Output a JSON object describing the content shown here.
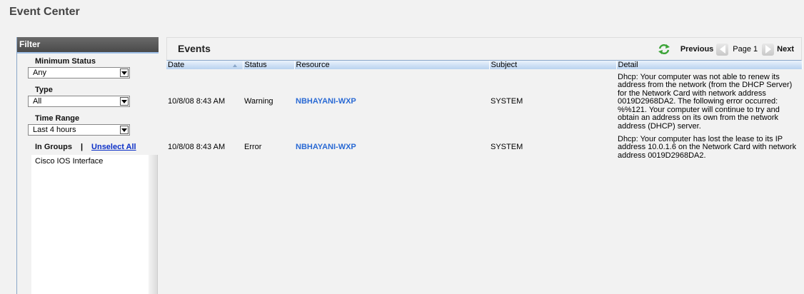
{
  "page": {
    "title": "Event Center"
  },
  "filter": {
    "header": "Filter",
    "minimum_status": {
      "label": "Minimum Status",
      "value": "Any"
    },
    "type": {
      "label": "Type",
      "value": "All"
    },
    "time_range": {
      "label": "Time Range",
      "value": "Last 4 hours"
    },
    "groups": {
      "label": "In Groups",
      "separator": "|",
      "unselect_all": "Unselect All",
      "items": [
        "Cisco IOS Interface"
      ]
    }
  },
  "events": {
    "title": "Events",
    "pager": {
      "previous": "Previous",
      "page": "Page 1",
      "next": "Next"
    },
    "columns": [
      "Date",
      "Status",
      "Resource",
      "Subject",
      "Detail"
    ],
    "rows": [
      {
        "date": "10/8/08 8:43 AM",
        "status": "Warning",
        "resource": "NBHAYANI-WXP",
        "subject": "SYSTEM",
        "detail": "Dhcp: Your computer was not able to renew its address from the network (from the DHCP Server) for the Network Card with network address 0019D2968DA2. The following error occurred: %%121. Your computer will continue to try and obtain an address on its own from the network address (DHCP) server."
      },
      {
        "date": "10/8/08 8:43 AM",
        "status": "Error",
        "resource": "NBHAYANI-WXP",
        "subject": "SYSTEM",
        "detail": "Dhcp: Your computer has lost the lease to its IP address 10.0.1.6 on the Network Card with network address 0019D2968DA2."
      }
    ]
  }
}
